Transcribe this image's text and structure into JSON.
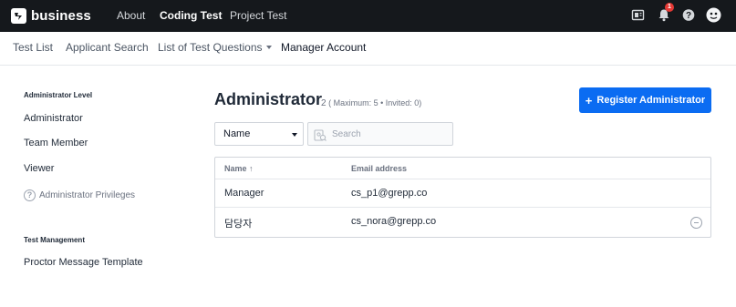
{
  "brand": {
    "name": "business"
  },
  "topnav": {
    "items": [
      {
        "label": "About",
        "active": false
      },
      {
        "label": "Coding Test",
        "active": true
      },
      {
        "label": "Project Test",
        "active": false
      }
    ],
    "notification_count": "1",
    "icons": [
      "manual-icon",
      "bell-icon",
      "help-icon",
      "avatar"
    ]
  },
  "subnav": {
    "items": [
      {
        "label": "Test List"
      },
      {
        "label": "Applicant Search"
      },
      {
        "label": "List of Test Questions"
      },
      {
        "label": "Manager Account"
      }
    ]
  },
  "sidebar": {
    "section1_heading": "Administrator Level",
    "section1_items": [
      {
        "label": "Administrator"
      },
      {
        "label": "Team Member"
      },
      {
        "label": "Viewer"
      }
    ],
    "help_link": "Administrator Privileges",
    "section2_heading": "Test Management",
    "section2_items": [
      {
        "label": "Proctor Message Template"
      }
    ]
  },
  "main": {
    "title": "Administrator",
    "count": "2",
    "subtitle": "( Maximum: 5 • Invited: 0)",
    "register_button": "Register Administrator",
    "filter": {
      "selected": "Name",
      "search_placeholder": "Search"
    },
    "table": {
      "columns": [
        "Name ↑",
        "Email address"
      ],
      "rows": [
        {
          "name": "Manager",
          "email": "cs_p1@grepp.co",
          "removable": false
        },
        {
          "name": "담당자",
          "email": "cs_nora@grepp.co",
          "removable": true
        }
      ]
    }
  },
  "colors": {
    "topbar_bg": "#15181c",
    "accent": "#0b6cf2",
    "badge": "#e53935"
  }
}
